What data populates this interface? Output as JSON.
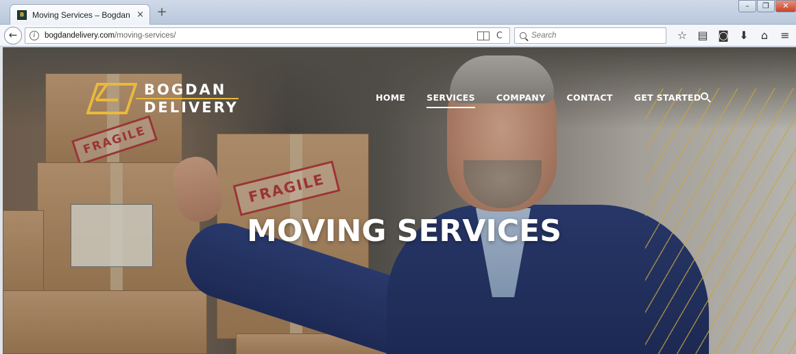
{
  "browser": {
    "tab_title": "Moving Services – Bogdan ...",
    "favicon_text": "B",
    "url_host": "bogdandelivery.com",
    "url_path": "/moving-services/",
    "search_placeholder": "Search",
    "new_tab": "+",
    "tab_close": "×",
    "icons": [
      "bookmark-star-icon",
      "reading-list-icon",
      "pocket-icon",
      "download-icon",
      "home-icon",
      "menu-icon"
    ]
  },
  "site": {
    "logo_line1": "BOGDAN",
    "logo_line2": "DELIVERY",
    "nav": [
      {
        "label": "HOME"
      },
      {
        "label": "SERVICES"
      },
      {
        "label": "COMPANY"
      },
      {
        "label": "CONTACT"
      },
      {
        "label": "GET STARTED"
      }
    ],
    "active_nav": "SERVICES",
    "hero_title": "MOVING SERVICES",
    "box_label": "FRAGILE",
    "accent_color": "#e9b93c"
  }
}
